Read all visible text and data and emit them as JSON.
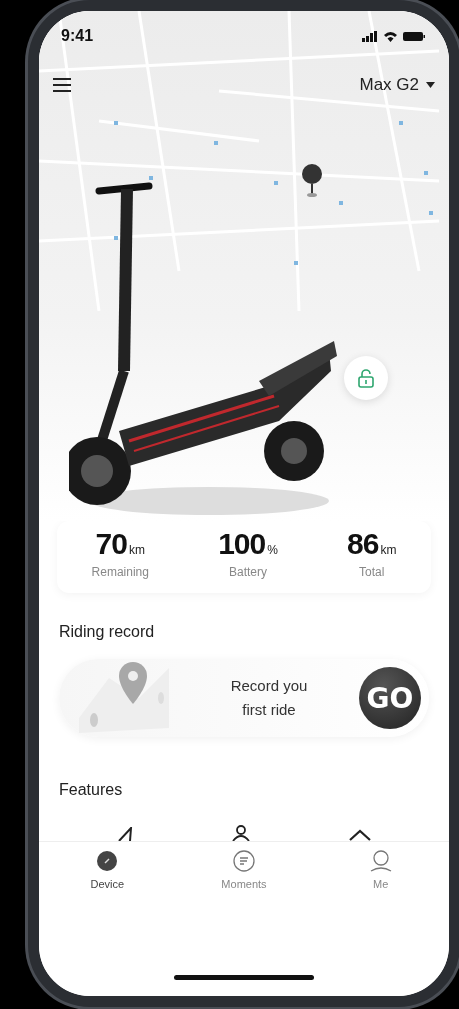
{
  "status_bar": {
    "time": "9:41"
  },
  "header": {
    "device_name": "Max G2"
  },
  "device": {
    "locked": false
  },
  "stats": [
    {
      "value": "70",
      "unit": "km",
      "label": "Remaining"
    },
    {
      "value": "100",
      "unit": "%",
      "label": "Battery"
    },
    {
      "value": "86",
      "unit": "km",
      "label": "Total"
    }
  ],
  "riding_record": {
    "title": "Riding record",
    "prompt": "Record you first ride",
    "button": "GO"
  },
  "features": {
    "title": "Features"
  },
  "tabs": [
    {
      "label": "Device",
      "selected": true
    },
    {
      "label": "Moments",
      "selected": false
    },
    {
      "label": "Me",
      "selected": false
    }
  ]
}
